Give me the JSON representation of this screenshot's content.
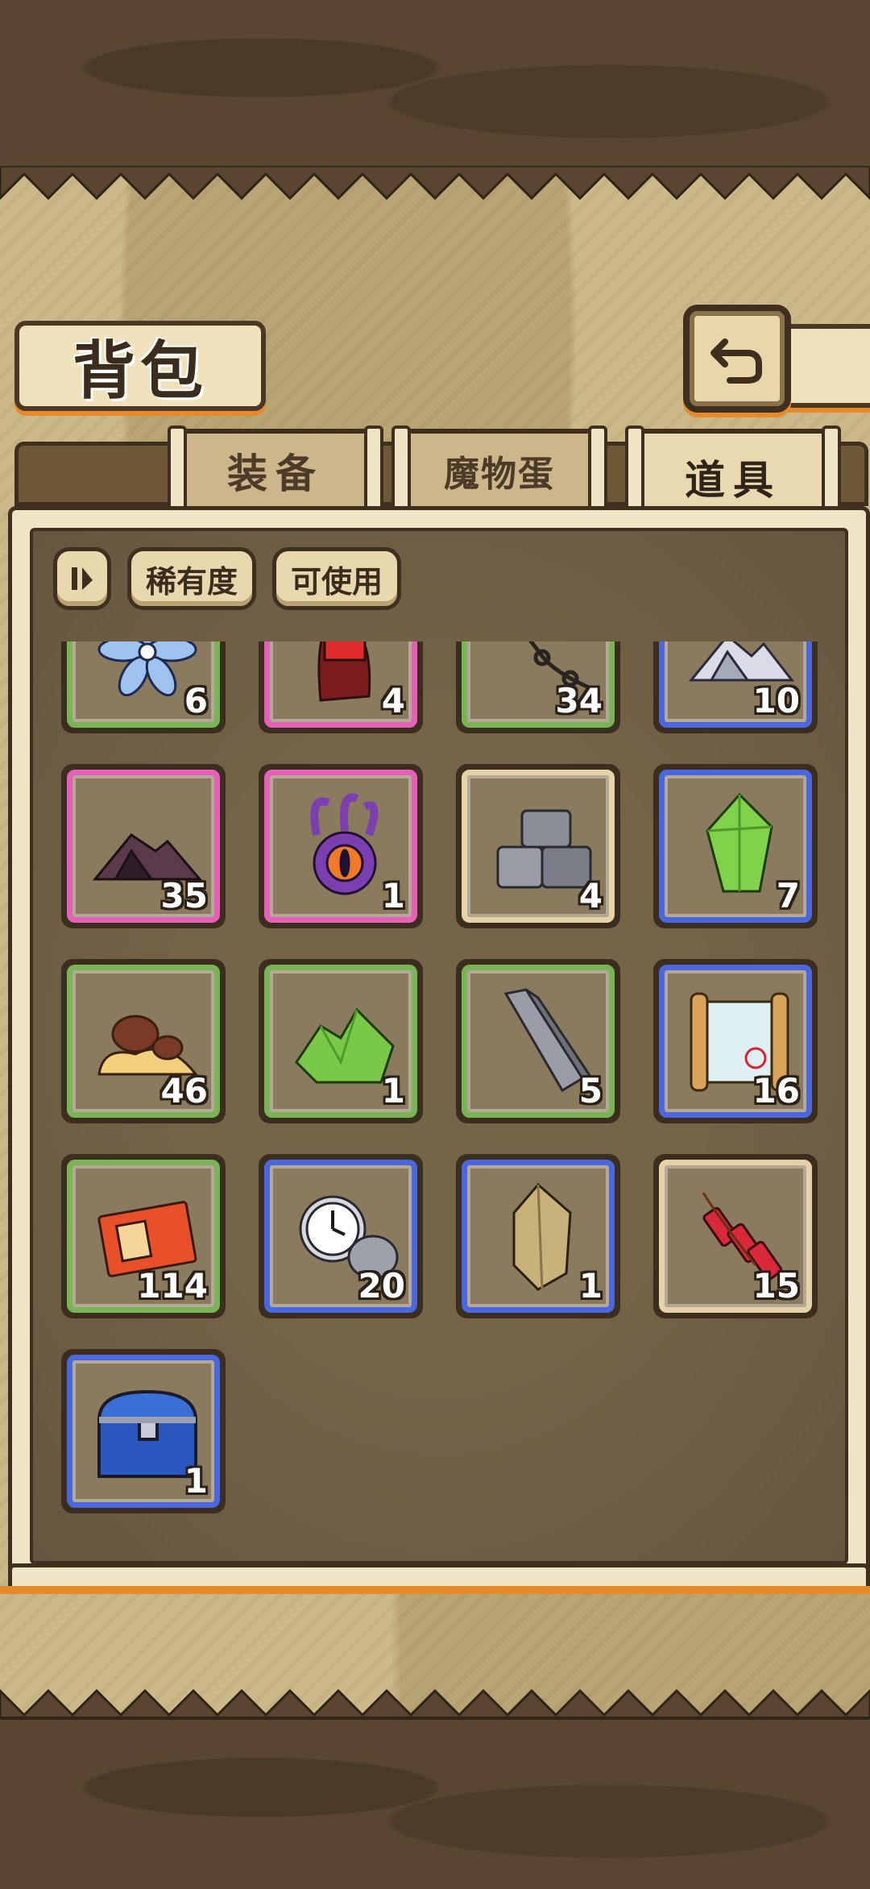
{
  "header": {
    "title": "背包"
  },
  "tabs": [
    {
      "label": "装备",
      "active": false
    },
    {
      "label": "魔物蛋",
      "active": false
    },
    {
      "label": "道具",
      "active": true
    }
  ],
  "filters": {
    "rarity_label": "稀有度",
    "usable_label": "可使用"
  },
  "rarity_colors": {
    "green": "#79b555",
    "pink": "#e660b8",
    "blue": "#4a67e0",
    "tan": "#e4d3a6"
  },
  "items": [
    {
      "icon": "blue-flower-icon",
      "rarity": "green",
      "count": "6"
    },
    {
      "icon": "cola-bottle-icon",
      "rarity": "pink",
      "count": "4"
    },
    {
      "icon": "chain-icon",
      "rarity": "green",
      "count": "34"
    },
    {
      "icon": "silver-powder-icon",
      "rarity": "blue",
      "count": "10"
    },
    {
      "icon": "dark-powder-icon",
      "rarity": "pink",
      "count": "35"
    },
    {
      "icon": "eye-tentacle-monster-icon",
      "rarity": "pink",
      "count": "1"
    },
    {
      "icon": "stone-blocks-icon",
      "rarity": "tan",
      "count": "4"
    },
    {
      "icon": "green-crystal-icon",
      "rarity": "blue",
      "count": "7"
    },
    {
      "icon": "mushroom-slime-icon",
      "rarity": "green",
      "count": "46"
    },
    {
      "icon": "green-ore-icon",
      "rarity": "green",
      "count": "1"
    },
    {
      "icon": "iron-bar-icon",
      "rarity": "green",
      "count": "5"
    },
    {
      "icon": "treasure-scroll-icon",
      "rarity": "blue",
      "count": "16"
    },
    {
      "icon": "ticket-card-icon",
      "rarity": "green",
      "count": "114"
    },
    {
      "icon": "pocket-watch-icon",
      "rarity": "blue",
      "count": "20"
    },
    {
      "icon": "gold-crystal-icon",
      "rarity": "blue",
      "count": "1"
    },
    {
      "icon": "firecracker-icon",
      "rarity": "tan",
      "count": "15"
    },
    {
      "icon": "blue-treasure-chest-icon",
      "rarity": "blue",
      "count": "1"
    }
  ]
}
